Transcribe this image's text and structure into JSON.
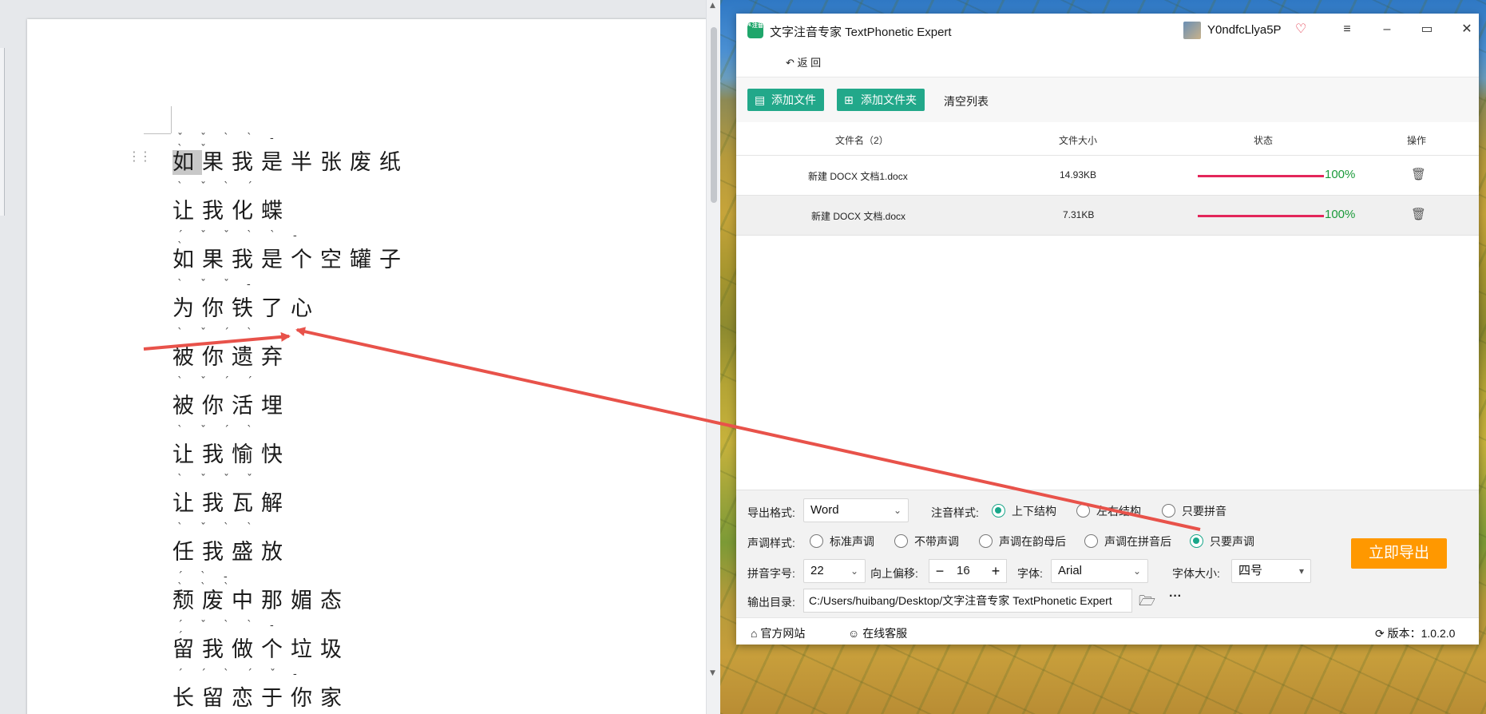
{
  "document": {
    "poem_lines": [
      {
        "text": "如果我是半张废纸",
        "tones": "ˇˇˋˋ-ˋˇ"
      },
      {
        "text": "让我化蝶",
        "tones": "ˋˇˋˊ"
      },
      {
        "text": "如果我是个空罐子",
        "tones": "ˊˇˇˋˋ-ˋ"
      },
      {
        "text": "为你铁了心",
        "tones": "ˋˇˇ-"
      },
      {
        "text": "被你遗弃",
        "tones": "ˋˇˊˋ"
      },
      {
        "text": "被你活埋",
        "tones": "ˋˇˊˊ"
      },
      {
        "text": "让我愉快",
        "tones": "ˋˇˊˋ"
      },
      {
        "text": "让我瓦解",
        "tones": "ˋˇˇˇ"
      },
      {
        "text": "任我盛放",
        "tones": "ˋˇˋˋ"
      },
      {
        "text": "颓废中那媚态",
        "tones": "ˊˋ-ˋˋˋ"
      },
      {
        "text": "留我做个垃圾",
        "tones": "ˊˇˋˋ-ˊ"
      },
      {
        "text": "长留恋于你家",
        "tones": "ˊˊˋˊˇ-"
      }
    ]
  },
  "app": {
    "title": "文字注音专家 TextPhonetic Expert",
    "logo_text": "ᴺᴸ注音",
    "user": "Y0ndfcLlya5P",
    "back_label": "返 回",
    "add_file_label": "添加文件",
    "add_folder_label": "添加文件夹",
    "clear_list_label": "清空列表",
    "columns": {
      "name": "文件名（2）",
      "size": "文件大小",
      "status": "状态",
      "action": "操作"
    },
    "files": [
      {
        "name": "新建 DOCX 文档1.docx",
        "size": "14.93KB",
        "progress": 100,
        "pct": "100%"
      },
      {
        "name": "新建 DOCX 文档.docx",
        "size": "7.31KB",
        "progress": 100,
        "pct": "100%"
      }
    ],
    "settings": {
      "export_format_label": "导出格式:",
      "export_format_value": "Word",
      "annotation_style_label": "注音样式:",
      "annotation_options": [
        "上下结构",
        "左右结构",
        "只要拼音"
      ],
      "tone_style_label": "声调样式:",
      "tone_options": [
        "标准声调",
        "不带声调",
        "声调在韵母后",
        "声调在拼音后",
        "只要声调"
      ],
      "pinyin_size_label": "拼音字号:",
      "pinyin_size_value": "22",
      "offset_label": "向上偏移:",
      "offset_value": "16",
      "font_label": "字体:",
      "font_value": "Arial",
      "font_size_label": "字体大小:",
      "font_size_value": "四号",
      "output_dir_label": "输出目录:",
      "output_dir_value": "C:/Users/huibang/Desktop/文字注音专家 TextPhonetic Expert",
      "export_button": "立即导出"
    },
    "footer": {
      "website": "官方网站",
      "support": "在线客服",
      "version": "版本：1.0.2.0"
    }
  },
  "colors": {
    "accent_green": "#22a88a",
    "export_orange": "#ff9800",
    "progress_red": "#e3265a",
    "pct_green": "#1a9a3a",
    "arrow_red": "#e8524a"
  }
}
